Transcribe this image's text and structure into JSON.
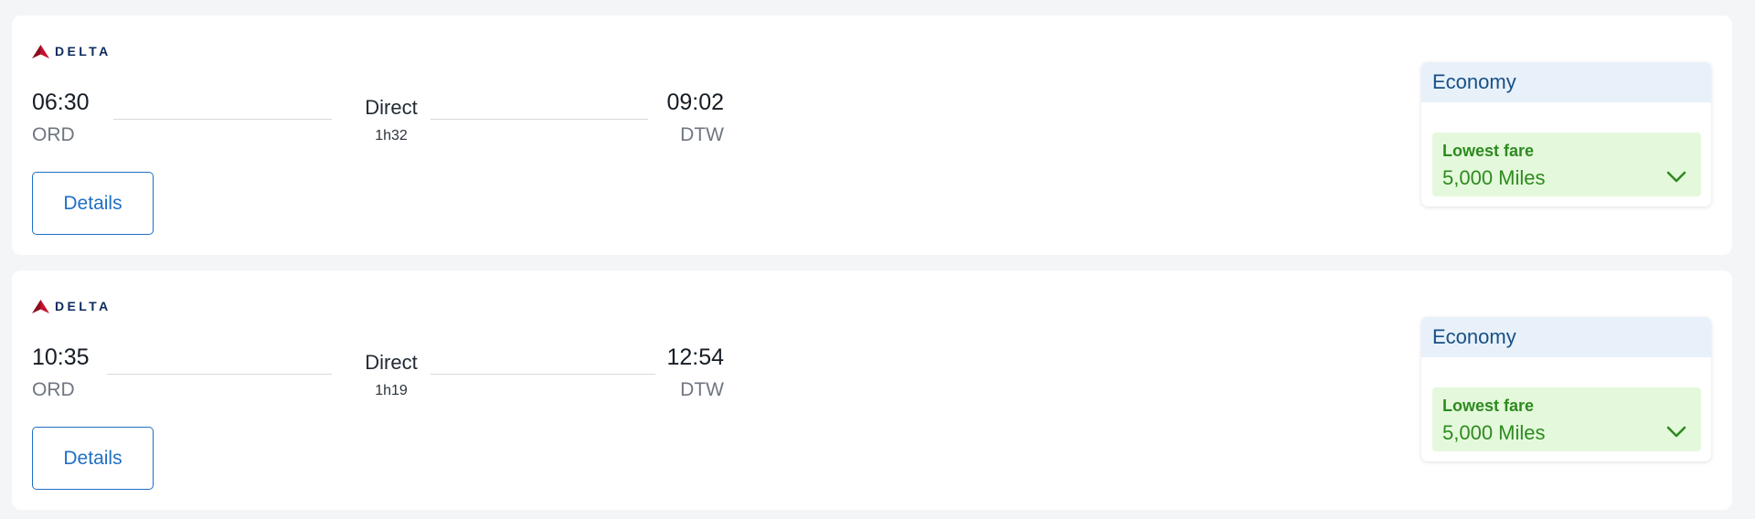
{
  "flights": [
    {
      "airline": "DELTA",
      "departure": {
        "time": "06:30",
        "airport": "ORD"
      },
      "arrival": {
        "time": "09:02",
        "airport": "DTW"
      },
      "stops": "Direct",
      "duration": "1h32",
      "details_label": "Details",
      "fare": {
        "cabin": "Economy",
        "label": "Lowest fare",
        "price": "5,000 Miles",
        "icon": "chevron-down-icon"
      }
    },
    {
      "airline": "DELTA",
      "departure": {
        "time": "10:35",
        "airport": "ORD"
      },
      "arrival": {
        "time": "12:54",
        "airport": "DTW"
      },
      "stops": "Direct",
      "duration": "1h19",
      "details_label": "Details",
      "fare": {
        "cabin": "Economy",
        "label": "Lowest fare",
        "price": "5,000 Miles",
        "icon": "chevron-down-icon"
      }
    }
  ],
  "colors": {
    "brand_red": "#c8102e",
    "brand_navy": "#0b2a5c",
    "link_blue": "#1f6fc4",
    "fare_green": "#2e8a1f",
    "fare_bg": "#e4f9dc",
    "cabin_header_bg": "#e8f1fa"
  }
}
